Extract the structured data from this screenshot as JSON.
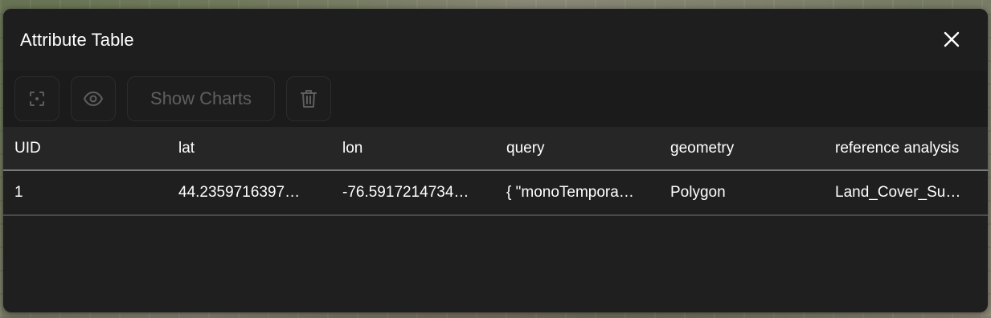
{
  "dialog": {
    "title": "Attribute Table",
    "close_icon": "close-icon"
  },
  "toolbar": {
    "select_icon": "focus-select-icon",
    "eye_icon": "eye-icon",
    "show_charts_label": "Show Charts",
    "trash_icon": "trash-icon"
  },
  "table": {
    "columns": [
      "UID",
      "lat",
      "lon",
      "query",
      "geometry",
      "reference analysis"
    ],
    "rows": [
      [
        "1",
        "44.2359716397…",
        "-76.5917214734…",
        "{ \"monoTempora…",
        "Polygon",
        "Land_Cover_Su…"
      ]
    ]
  },
  "colors": {
    "panel_bg": "#1f1f1f",
    "toolbar_bg": "#1b1b1b",
    "header_row_bg": "#262626",
    "text": "#ffffff",
    "disabled_text": "#5f5f5f"
  }
}
